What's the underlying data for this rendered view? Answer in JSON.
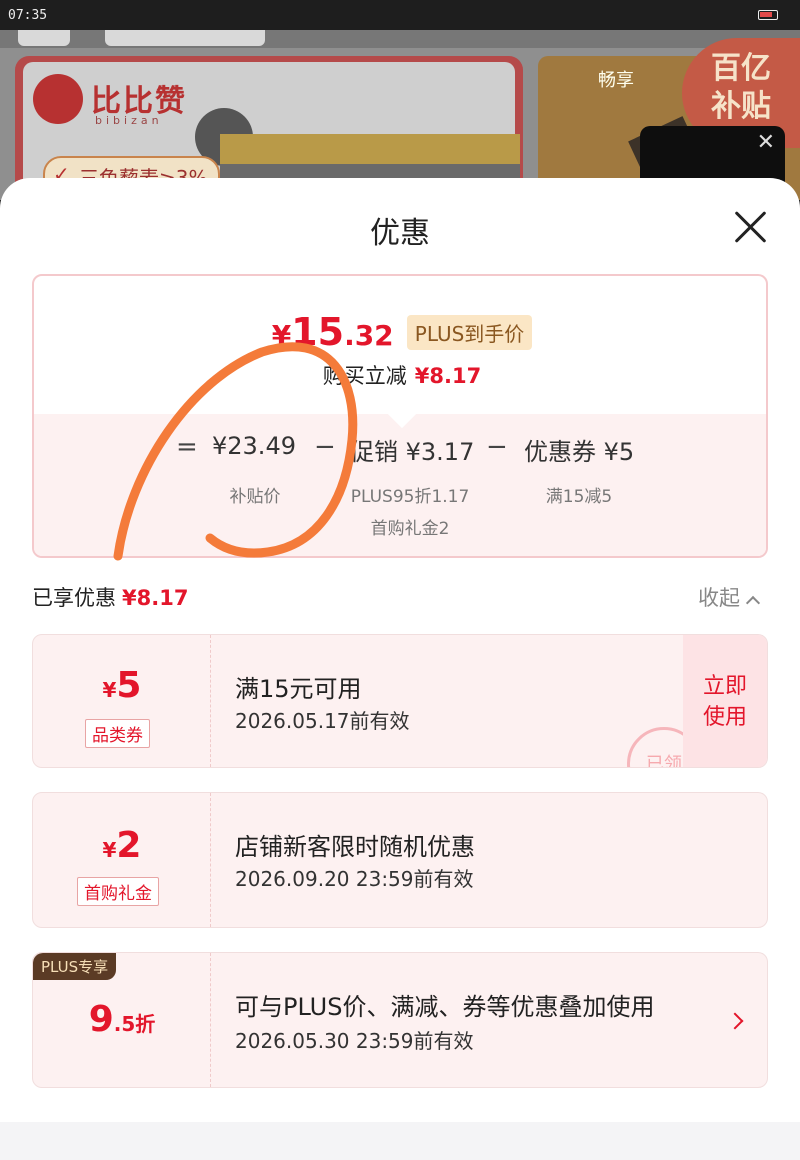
{
  "status_bar": {
    "time": "07:35"
  },
  "background": {
    "brand_name": "比比赞",
    "brand_sub": "bibizan",
    "banner_tag": "三色藜麦≥3%",
    "subsidy_line1": "百亿",
    "subsidy_line2": "补贴",
    "banner2_text": "畅享"
  },
  "sheet": {
    "title": "优惠",
    "summary": {
      "price_yen": "¥",
      "price_int": "15",
      "price_dec": ".32",
      "price_tag": "PLUS到手价",
      "reduce_label": "购买立减",
      "reduce_amount": "¥8.17",
      "eq": "=",
      "minus": "−",
      "base_price": "¥23.49",
      "base_label": "补贴价",
      "promo": "促销 ¥3.17",
      "promo_sub1": "PLUS95折1.17",
      "promo_sub2": "首购礼金2",
      "coupon": "优惠券 ¥5",
      "coupon_sub": "满15减5"
    },
    "applied": {
      "label": "已享优惠",
      "amount": "¥8.17",
      "collapse": "收起"
    },
    "coupons": [
      {
        "yen": "¥",
        "value": "5",
        "badge": "品类券",
        "title": "满15元可用",
        "date": "2026.05.17前有效",
        "action": "立即使用",
        "action_line1": "立即",
        "action_line2": "使用",
        "stamp": "已领"
      },
      {
        "yen": "¥",
        "value": "2",
        "badge": "首购礼金",
        "title": "店铺新客限时随机优惠",
        "date": "2026.09.20 23:59前有效"
      },
      {
        "corner": "PLUS专享",
        "value_big": "9",
        "value_small": ".5折",
        "title": "可与PLUS价、满减、券等优惠叠加使用",
        "date": "2026.05.30 23:59前有效"
      }
    ]
  },
  "colors": {
    "accent": "#e3162b",
    "plus_tag_bg": "#fbe6c5",
    "scribble": "#f47b3a"
  }
}
